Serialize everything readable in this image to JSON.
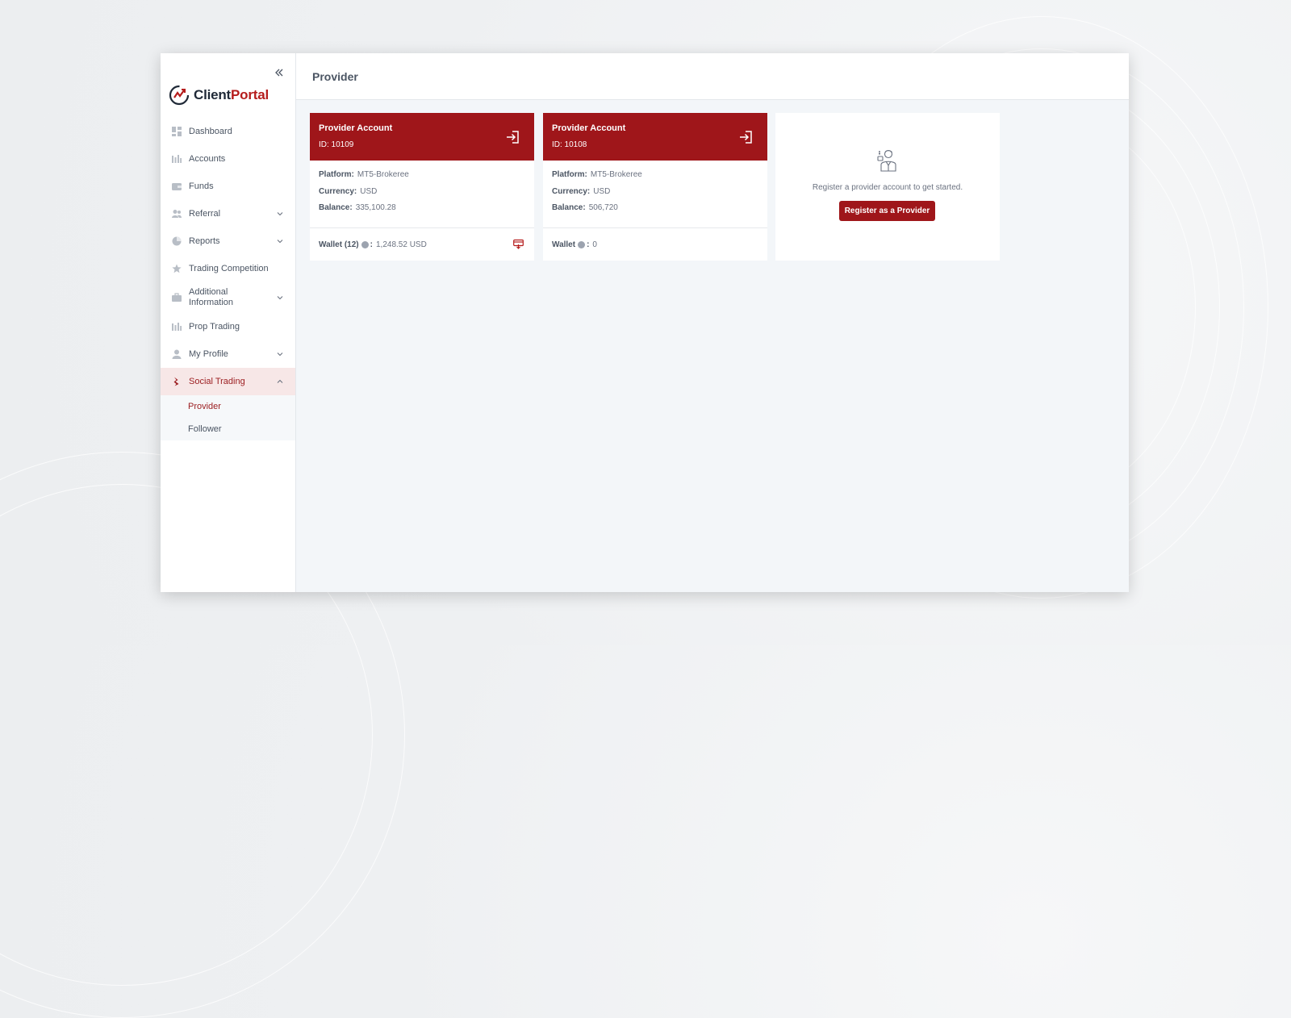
{
  "app": {
    "logo_part1": "Client",
    "logo_part2": "Portal",
    "brand_color": "#9f161a"
  },
  "sidebar": {
    "items": [
      {
        "label": "Dashboard",
        "icon": "dashboard-icon"
      },
      {
        "label": "Accounts",
        "icon": "accounts-icon"
      },
      {
        "label": "Funds",
        "icon": "wallet-icon"
      },
      {
        "label": "Referral",
        "icon": "users-icon",
        "expandable": true
      },
      {
        "label": "Reports",
        "icon": "pie-chart-icon",
        "expandable": true
      },
      {
        "label": "Trading Competition",
        "icon": "star-icon"
      },
      {
        "label": "Additional Information",
        "icon": "briefcase-icon",
        "expandable": true
      },
      {
        "label": "Prop Trading",
        "icon": "prop-trading-icon"
      },
      {
        "label": "My Profile",
        "icon": "user-icon",
        "expandable": true
      },
      {
        "label": "Social Trading",
        "icon": "social-trading-icon",
        "expandable": true,
        "expanded": true,
        "active": true
      }
    ],
    "submenu": [
      {
        "label": "Provider",
        "active": true
      },
      {
        "label": "Follower"
      }
    ]
  },
  "page": {
    "title": "Provider"
  },
  "accounts": [
    {
      "title": "Provider Account",
      "id": "ID: 10109",
      "platform_label": "Platform:",
      "platform": "MT5-Brokeree",
      "currency_label": "Currency:",
      "currency": "USD",
      "balance_label": "Balance:",
      "balance": "335,100.28",
      "wallet_label": "Wallet (12)",
      "wallet_value": "1,248.52 USD"
    },
    {
      "title": "Provider Account",
      "id": "ID: 10108",
      "platform_label": "Platform:",
      "platform": "MT5-Brokeree",
      "currency_label": "Currency:",
      "currency": "USD",
      "balance_label": "Balance:",
      "balance": "506,720",
      "wallet_label": "Wallet",
      "wallet_value": "0"
    }
  ],
  "register": {
    "text": "Register a provider account to get started.",
    "button": "Register as a Provider"
  }
}
